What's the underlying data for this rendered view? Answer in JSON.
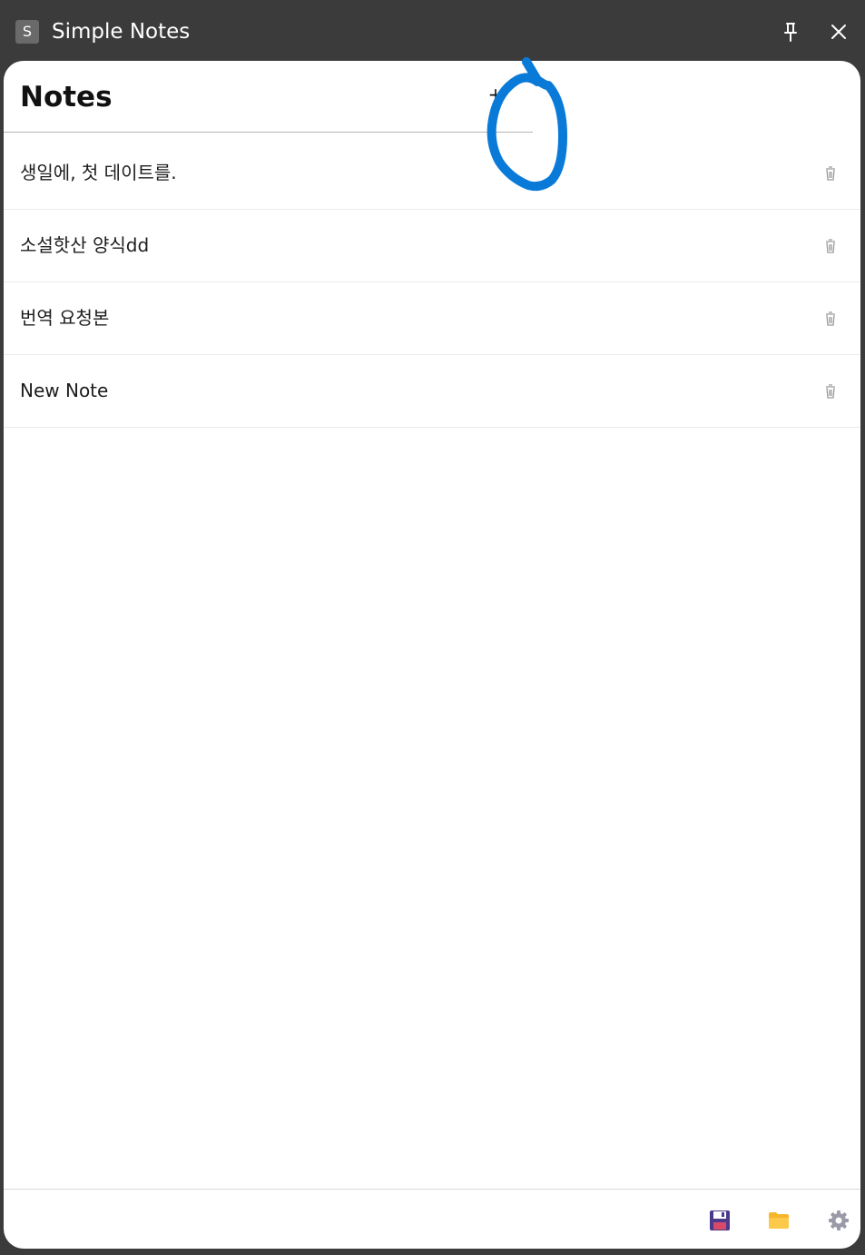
{
  "titlebar": {
    "app_icon_letter": "S",
    "title": "Simple Notes",
    "pin_icon": "pin-icon",
    "close_icon": "close-icon"
  },
  "header": {
    "heading": "Notes",
    "add_label": "+"
  },
  "notes": [
    {
      "title": "생일에, 첫 데이트를."
    },
    {
      "title": "소설핫산 양식dd"
    },
    {
      "title": "번역 요청본"
    },
    {
      "title": "New Note"
    }
  ],
  "footer": {
    "save_icon": "save-icon",
    "open_icon": "folder-icon",
    "settings_icon": "gear-icon"
  },
  "colors": {
    "titlebar_bg": "#3b3b3b",
    "annotation_blue": "#0a7ad8",
    "folder_yellow": "#f7b52a",
    "save_purple": "#4b3a8c",
    "gear_gray": "#9a9aa8"
  }
}
